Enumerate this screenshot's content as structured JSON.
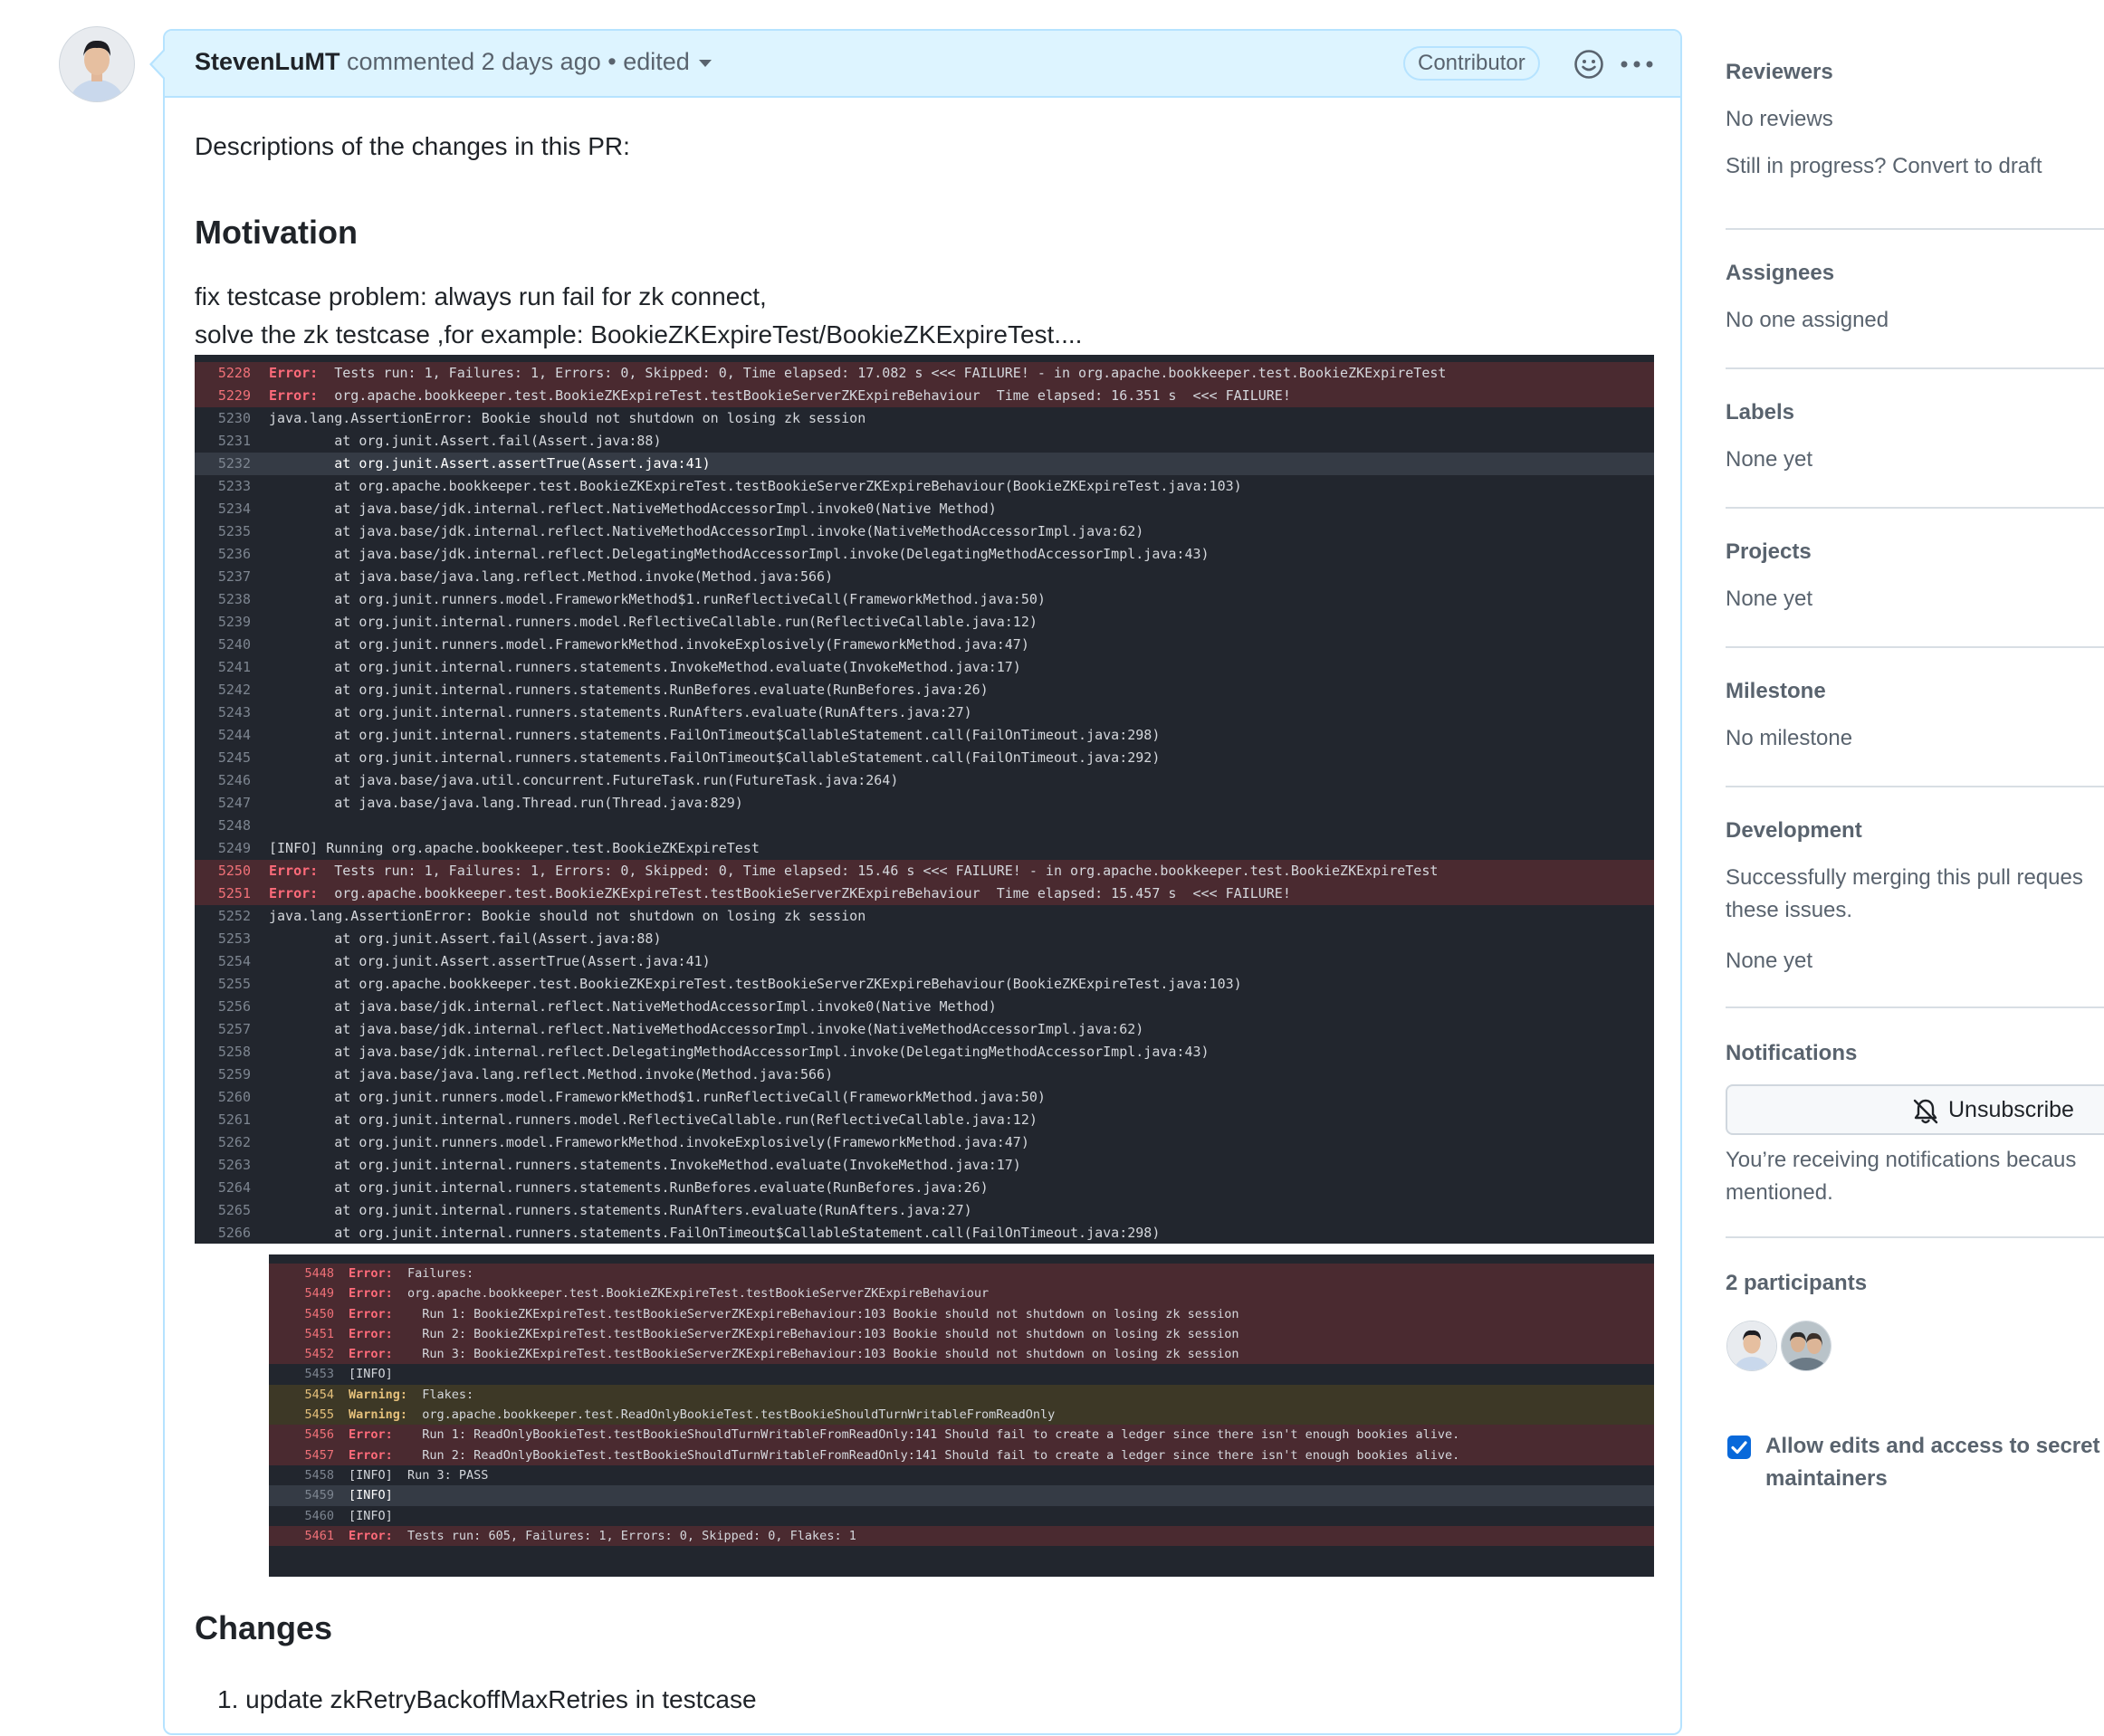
{
  "comment": {
    "author": "StevenLuMT",
    "action": "commented",
    "time": "2 days ago",
    "separator": "•",
    "edited": "edited",
    "badge": "Contributor",
    "intro": "Descriptions of the changes in this PR:",
    "motivation_heading": "Motivation",
    "motivation_line1": "fix testcase problem: always run fail for zk connect,",
    "motivation_line2": "solve the zk testcase ,for example: BookieZKExpireTest/BookieZKExpireTest....",
    "changes_heading": "Changes",
    "changes_items": [
      "update zkRetryBackoffMaxRetries in testcase"
    ]
  },
  "code_block_1": {
    "lines": [
      {
        "n": "5228",
        "type": "err",
        "tag": "Error:",
        "text": "  Tests run: 1, Failures: 1, Errors: 0, Skipped: 0, Time elapsed: 17.082 s <<< FAILURE! - in org.apache.bookkeeper.test.BookieZKExpireTest"
      },
      {
        "n": "5229",
        "type": "err",
        "tag": "Error:",
        "text": "  org.apache.bookkeeper.test.BookieZKExpireTest.testBookieServerZKExpireBehaviour  Time elapsed: 16.351 s  <<< FAILURE!"
      },
      {
        "n": "5230",
        "type": "",
        "tag": "",
        "text": "java.lang.AssertionError: Bookie should not shutdown on losing zk session"
      },
      {
        "n": "5231",
        "type": "",
        "tag": "",
        "text": "        at org.junit.Assert.fail(Assert.java:88)"
      },
      {
        "n": "5232",
        "type": "hl",
        "tag": "",
        "text": "        at org.junit.Assert.assertTrue(Assert.java:41)"
      },
      {
        "n": "5233",
        "type": "",
        "tag": "",
        "text": "        at org.apache.bookkeeper.test.BookieZKExpireTest.testBookieServerZKExpireBehaviour(BookieZKExpireTest.java:103)"
      },
      {
        "n": "5234",
        "type": "",
        "tag": "",
        "text": "        at java.base/jdk.internal.reflect.NativeMethodAccessorImpl.invoke0(Native Method)"
      },
      {
        "n": "5235",
        "type": "",
        "tag": "",
        "text": "        at java.base/jdk.internal.reflect.NativeMethodAccessorImpl.invoke(NativeMethodAccessorImpl.java:62)"
      },
      {
        "n": "5236",
        "type": "",
        "tag": "",
        "text": "        at java.base/jdk.internal.reflect.DelegatingMethodAccessorImpl.invoke(DelegatingMethodAccessorImpl.java:43)"
      },
      {
        "n": "5237",
        "type": "",
        "tag": "",
        "text": "        at java.base/java.lang.reflect.Method.invoke(Method.java:566)"
      },
      {
        "n": "5238",
        "type": "",
        "tag": "",
        "text": "        at org.junit.runners.model.FrameworkMethod$1.runReflectiveCall(FrameworkMethod.java:50)"
      },
      {
        "n": "5239",
        "type": "",
        "tag": "",
        "text": "        at org.junit.internal.runners.model.ReflectiveCallable.run(ReflectiveCallable.java:12)"
      },
      {
        "n": "5240",
        "type": "",
        "tag": "",
        "text": "        at org.junit.runners.model.FrameworkMethod.invokeExplosively(FrameworkMethod.java:47)"
      },
      {
        "n": "5241",
        "type": "",
        "tag": "",
        "text": "        at org.junit.internal.runners.statements.InvokeMethod.evaluate(InvokeMethod.java:17)"
      },
      {
        "n": "5242",
        "type": "",
        "tag": "",
        "text": "        at org.junit.internal.runners.statements.RunBefores.evaluate(RunBefores.java:26)"
      },
      {
        "n": "5243",
        "type": "",
        "tag": "",
        "text": "        at org.junit.internal.runners.statements.RunAfters.evaluate(RunAfters.java:27)"
      },
      {
        "n": "5244",
        "type": "",
        "tag": "",
        "text": "        at org.junit.internal.runners.statements.FailOnTimeout$CallableStatement.call(FailOnTimeout.java:298)"
      },
      {
        "n": "5245",
        "type": "",
        "tag": "",
        "text": "        at org.junit.internal.runners.statements.FailOnTimeout$CallableStatement.call(FailOnTimeout.java:292)"
      },
      {
        "n": "5246",
        "type": "",
        "tag": "",
        "text": "        at java.base/java.util.concurrent.FutureTask.run(FutureTask.java:264)"
      },
      {
        "n": "5247",
        "type": "",
        "tag": "",
        "text": "        at java.base/java.lang.Thread.run(Thread.java:829)"
      },
      {
        "n": "5248",
        "type": "",
        "tag": "",
        "text": ""
      },
      {
        "n": "5249",
        "type": "",
        "tag": "",
        "text": "[INFO] Running org.apache.bookkeeper.test.BookieZKExpireTest"
      },
      {
        "n": "5250",
        "type": "err",
        "tag": "Error:",
        "text": "  Tests run: 1, Failures: 1, Errors: 0, Skipped: 0, Time elapsed: 15.46 s <<< FAILURE! - in org.apache.bookkeeper.test.BookieZKExpireTest"
      },
      {
        "n": "5251",
        "type": "err",
        "tag": "Error:",
        "text": "  org.apache.bookkeeper.test.BookieZKExpireTest.testBookieServerZKExpireBehaviour  Time elapsed: 15.457 s  <<< FAILURE!"
      },
      {
        "n": "5252",
        "type": "",
        "tag": "",
        "text": "java.lang.AssertionError: Bookie should not shutdown on losing zk session"
      },
      {
        "n": "5253",
        "type": "",
        "tag": "",
        "text": "        at org.junit.Assert.fail(Assert.java:88)"
      },
      {
        "n": "5254",
        "type": "",
        "tag": "",
        "text": "        at org.junit.Assert.assertTrue(Assert.java:41)"
      },
      {
        "n": "5255",
        "type": "",
        "tag": "",
        "text": "        at org.apache.bookkeeper.test.BookieZKExpireTest.testBookieServerZKExpireBehaviour(BookieZKExpireTest.java:103)"
      },
      {
        "n": "5256",
        "type": "",
        "tag": "",
        "text": "        at java.base/jdk.internal.reflect.NativeMethodAccessorImpl.invoke0(Native Method)"
      },
      {
        "n": "5257",
        "type": "",
        "tag": "",
        "text": "        at java.base/jdk.internal.reflect.NativeMethodAccessorImpl.invoke(NativeMethodAccessorImpl.java:62)"
      },
      {
        "n": "5258",
        "type": "",
        "tag": "",
        "text": "        at java.base/jdk.internal.reflect.DelegatingMethodAccessorImpl.invoke(DelegatingMethodAccessorImpl.java:43)"
      },
      {
        "n": "5259",
        "type": "",
        "tag": "",
        "text": "        at java.base/java.lang.reflect.Method.invoke(Method.java:566)"
      },
      {
        "n": "5260",
        "type": "",
        "tag": "",
        "text": "        at org.junit.runners.model.FrameworkMethod$1.runReflectiveCall(FrameworkMethod.java:50)"
      },
      {
        "n": "5261",
        "type": "",
        "tag": "",
        "text": "        at org.junit.internal.runners.model.ReflectiveCallable.run(ReflectiveCallable.java:12)"
      },
      {
        "n": "5262",
        "type": "",
        "tag": "",
        "text": "        at org.junit.runners.model.FrameworkMethod.invokeExplosively(FrameworkMethod.java:47)"
      },
      {
        "n": "5263",
        "type": "",
        "tag": "",
        "text": "        at org.junit.internal.runners.statements.InvokeMethod.evaluate(InvokeMethod.java:17)"
      },
      {
        "n": "5264",
        "type": "",
        "tag": "",
        "text": "        at org.junit.internal.runners.statements.RunBefores.evaluate(RunBefores.java:26)"
      },
      {
        "n": "5265",
        "type": "",
        "tag": "",
        "text": "        at org.junit.internal.runners.statements.RunAfters.evaluate(RunAfters.java:27)"
      },
      {
        "n": "5266",
        "type": "",
        "tag": "",
        "text": "        at org.junit.internal.runners.statements.FailOnTimeout$CallableStatement.call(FailOnTimeout.java:298)"
      }
    ]
  },
  "code_block_2": {
    "lines": [
      {
        "n": "5448",
        "type": "err",
        "tag": "Error:",
        "text": "  Failures:"
      },
      {
        "n": "5449",
        "type": "err",
        "tag": "Error:",
        "text": "  org.apache.bookkeeper.test.BookieZKExpireTest.testBookieServerZKExpireBehaviour"
      },
      {
        "n": "5450",
        "type": "err",
        "tag": "Error:",
        "text": "    Run 1: BookieZKExpireTest.testBookieServerZKExpireBehaviour:103 Bookie should not shutdown on losing zk session"
      },
      {
        "n": "5451",
        "type": "err",
        "tag": "Error:",
        "text": "    Run 2: BookieZKExpireTest.testBookieServerZKExpireBehaviour:103 Bookie should not shutdown on losing zk session"
      },
      {
        "n": "5452",
        "type": "err",
        "tag": "Error:",
        "text": "    Run 3: BookieZKExpireTest.testBookieServerZKExpireBehaviour:103 Bookie should not shutdown on losing zk session"
      },
      {
        "n": "5453",
        "type": "",
        "tag": "",
        "text": "[INFO]"
      },
      {
        "n": "5454",
        "type": "warn",
        "tag": "Warning:",
        "text": "  Flakes:"
      },
      {
        "n": "5455",
        "type": "warn",
        "tag": "Warning:",
        "text": "  org.apache.bookkeeper.test.ReadOnlyBookieTest.testBookieShouldTurnWritableFromReadOnly"
      },
      {
        "n": "5456",
        "type": "err",
        "tag": "Error:",
        "text": "    Run 1: ReadOnlyBookieTest.testBookieShouldTurnWritableFromReadOnly:141 Should fail to create a ledger since there isn't enough bookies alive."
      },
      {
        "n": "5457",
        "type": "err",
        "tag": "Error:",
        "text": "    Run 2: ReadOnlyBookieTest.testBookieShouldTurnWritableFromReadOnly:141 Should fail to create a ledger since there isn't enough bookies alive."
      },
      {
        "n": "5458",
        "type": "",
        "tag": "",
        "text": "[INFO]  Run 3: PASS"
      },
      {
        "n": "5459",
        "type": "hl",
        "tag": "",
        "text": "[INFO]"
      },
      {
        "n": "5460",
        "type": "",
        "tag": "",
        "text": "[INFO]"
      },
      {
        "n": "5461",
        "type": "err",
        "tag": "Error:",
        "text": "  Tests run: 605, Failures: 1, Errors: 0, Skipped: 0, Flakes: 1"
      }
    ]
  },
  "sidebar": {
    "reviewers_heading": "Reviewers",
    "reviewers_value": "No reviews",
    "reviewers_link": "Still in progress? Convert to draft",
    "assignees_heading": "Assignees",
    "assignees_value": "No one assigned",
    "labels_heading": "Labels",
    "labels_value": "None yet",
    "projects_heading": "Projects",
    "projects_value": "None yet",
    "milestone_heading": "Milestone",
    "milestone_value": "No milestone",
    "development_heading": "Development",
    "development_line1": "Successfully merging this pull reques",
    "development_line2": "these issues.",
    "development_value": "None yet",
    "notifications_heading": "Notifications",
    "unsubscribe_label": "Unsubscribe",
    "notif_line1": "You’re receiving notifications becaus",
    "notif_line2": "mentioned.",
    "participants_heading": "2 participants",
    "allow_line1": "Allow edits and access to secret",
    "allow_line2": "maintainers"
  },
  "colors": {
    "header_bg": "#ddf4ff",
    "header_border": "#b6e3ff",
    "code_bg": "#22262e",
    "error_row": "#4a2a30",
    "warning_row": "#3d3826",
    "checkbox": "#0969da"
  },
  "icons": [
    "smiley-icon",
    "kebab-icon",
    "caret-down-icon",
    "bell-slash-icon",
    "check-icon"
  ]
}
